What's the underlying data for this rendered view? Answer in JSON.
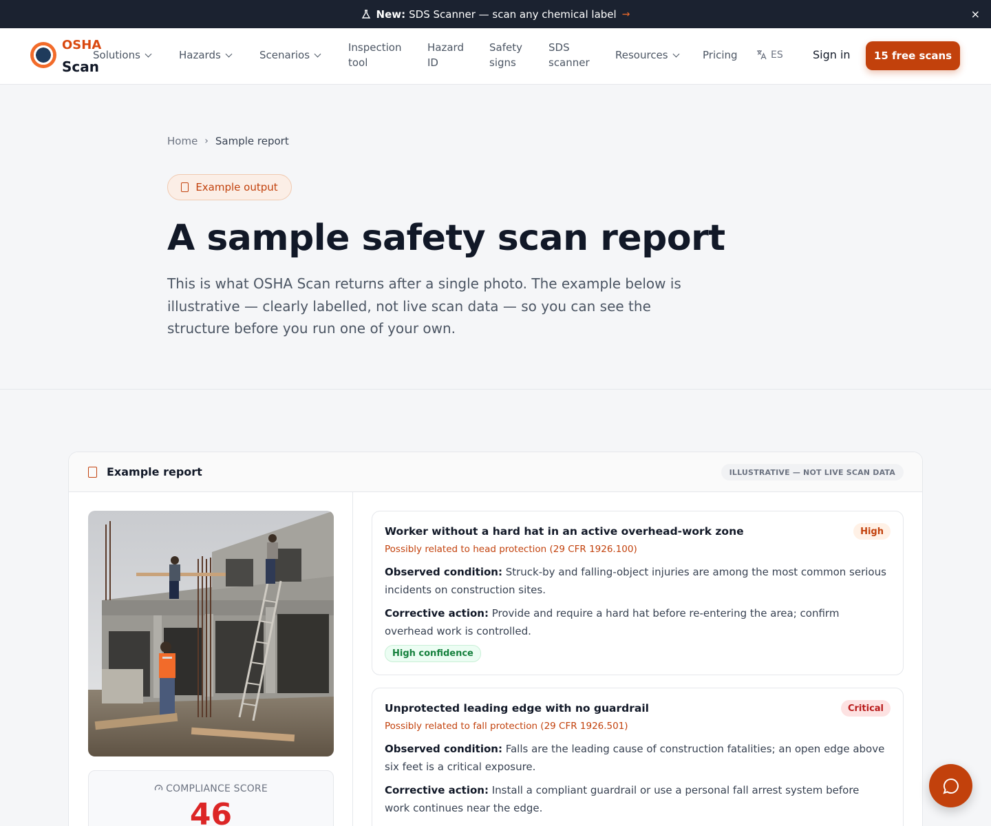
{
  "announce": {
    "badge": "New:",
    "text": "SDS Scanner — scan any chemical label",
    "arrow": "→",
    "close": "×"
  },
  "brand": {
    "line1": "OSHA",
    "line2": "Scan"
  },
  "nav": {
    "solutions": "Solutions",
    "hazards": "Hazards",
    "scenarios": "Scenarios",
    "inspection_l1": "Inspection",
    "inspection_l2": "tool",
    "hazardid_l1": "Hazard",
    "hazardid_l2": "ID",
    "signs_l1": "Safety",
    "signs_l2": "signs",
    "sds_l1": "SDS",
    "sds_l2": "scanner",
    "resources": "Resources",
    "pricing": "Pricing",
    "lang": "ES",
    "signin": "Sign in",
    "cta": "15 free scans"
  },
  "breadcrumb": {
    "home": "Home",
    "sep": "›",
    "current": "Sample report"
  },
  "hero": {
    "pill": "Example output",
    "title": "A sample safety scan report",
    "lead": "This is what OSHA Scan returns after a single photo. The example below is illustrative — clearly labelled, not live scan data — so you can see the structure before you run one of your own."
  },
  "report": {
    "title": "Example report",
    "badge": "ILLUSTRATIVE — NOT LIVE SCAN DATA",
    "score_label": "COMPLIANCE SCORE",
    "score_value": "46",
    "findings": [
      {
        "title": "Worker without a hard hat in an active overhead-work zone",
        "severity": "High",
        "related": "Possibly related to head protection (29 CFR 1926.100)",
        "obs_label": "Observed condition:",
        "obs": "Struck-by and falling-object injuries are among the most common serious incidents on construction sites.",
        "cor_label": "Corrective action:",
        "cor": "Provide and require a hard hat before re-entering the area; confirm overhead work is controlled.",
        "confidence": "High confidence"
      },
      {
        "title": "Unprotected leading edge with no guardrail",
        "severity": "Critical",
        "related": "Possibly related to fall protection (29 CFR 1926.501)",
        "obs_label": "Observed condition:",
        "obs": "Falls are the leading cause of construction fatalities; an open edge above six feet is a critical exposure.",
        "cor_label": "Corrective action:",
        "cor": "Install a compliant guardrail or use a personal fall arrest system before work continues near the edge."
      }
    ]
  },
  "colors": {
    "accent": "#c2410c",
    "dark": "#1b2230",
    "critical": "#dc2626"
  }
}
